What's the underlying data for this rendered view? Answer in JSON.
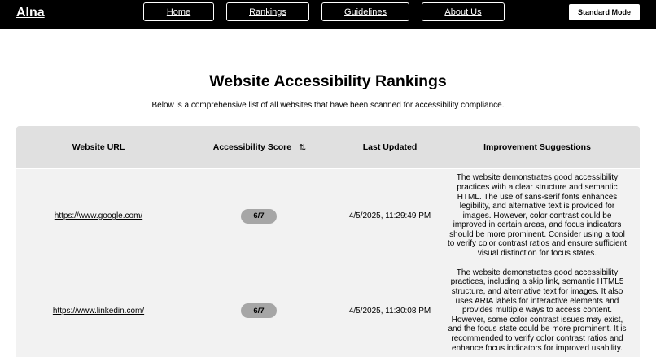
{
  "nav": {
    "brand": "AIna",
    "links": [
      "Home",
      "Rankings",
      "Guidelines",
      "About Us"
    ],
    "mode_button": "Standard Mode"
  },
  "page": {
    "title": "Website Accessibility Rankings",
    "subtitle": "Below is a comprehensive list of all websites that have been scanned for accessibility compliance."
  },
  "table": {
    "headers": [
      "Website URL",
      "Accessibility Score",
      "Last Updated",
      "Improvement Suggestions"
    ],
    "sort_icon": "⇅",
    "rows": [
      {
        "url": "https://www.google.com/",
        "score": "6/7",
        "updated": "4/5/2025, 11:29:49 PM",
        "suggestion": "The website demonstrates good accessibility practices with a clear structure and semantic HTML. The use of sans-serif fonts enhances legibility, and alternative text is provided for images. However, color contrast could be improved in certain areas, and focus indicators should be more prominent. Consider using a tool to verify color contrast ratios and ensure sufficient visual distinction for focus states."
      },
      {
        "url": "https://www.linkedin.com/",
        "score": "6/7",
        "updated": "4/5/2025, 11:30:08 PM",
        "suggestion": "The website demonstrates good accessibility practices, including a skip link, semantic HTML5 structure, and alternative text for images. It also uses ARIA labels for interactive elements and provides multiple ways to access content. However, some color contrast issues may exist, and the focus state could be more prominent. It is recommended to verify color contrast ratios and enhance focus indicators for improved usability."
      }
    ]
  }
}
